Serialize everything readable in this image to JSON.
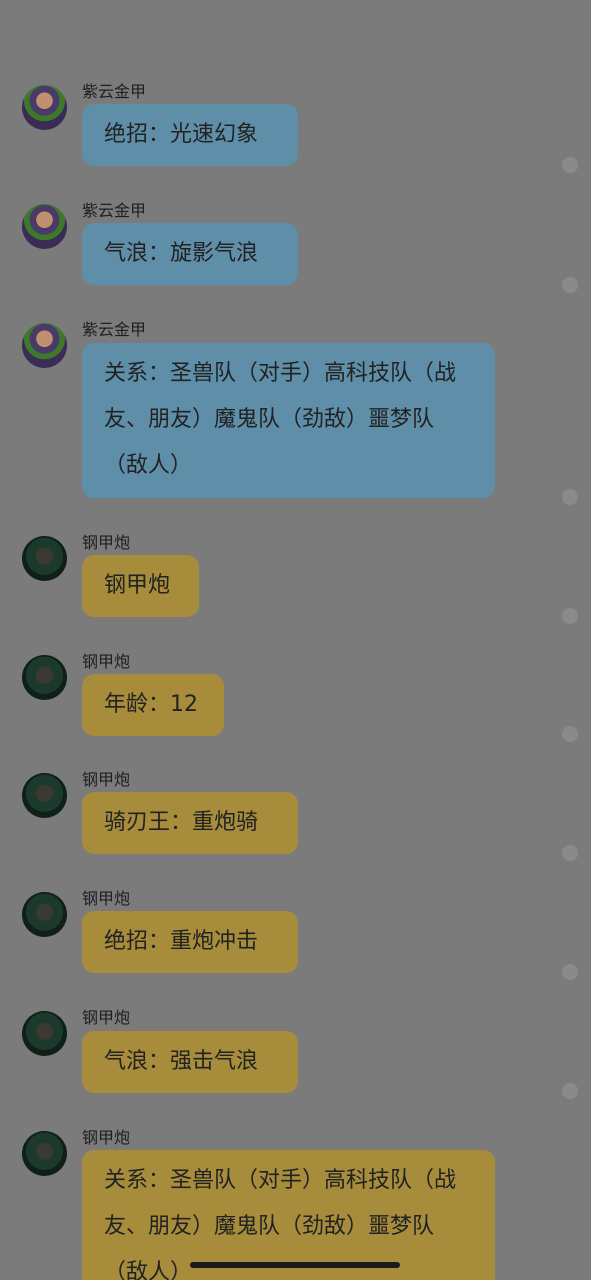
{
  "messages": [
    {
      "sender": "紫云金甲",
      "text": "绝招：光速幻象",
      "style": "blue",
      "avatar": "avatar-purple"
    },
    {
      "sender": "紫云金甲",
      "text": "气浪：旋影气浪",
      "style": "blue",
      "avatar": "avatar-purple"
    },
    {
      "sender": "紫云金甲",
      "text": "关系：圣兽队（对手）高科技队（战友、朋友）魔鬼队（劲敌）噩梦队（敌人）",
      "style": "blue",
      "avatar": "avatar-purple"
    },
    {
      "sender": "钢甲炮",
      "text": "钢甲炮",
      "style": "yellow",
      "avatar": "avatar-green"
    },
    {
      "sender": "钢甲炮",
      "text": "年龄：12",
      "style": "yellow",
      "avatar": "avatar-green"
    },
    {
      "sender": "钢甲炮",
      "text": "骑刃王：重炮骑",
      "style": "yellow",
      "avatar": "avatar-green"
    },
    {
      "sender": "钢甲炮",
      "text": "绝招：重炮冲击",
      "style": "yellow",
      "avatar": "avatar-green"
    },
    {
      "sender": "钢甲炮",
      "text": "气浪：强击气浪",
      "style": "yellow",
      "avatar": "avatar-green"
    },
    {
      "sender": "钢甲炮",
      "text": "关系：圣兽队（对手）高科技队（战友、朋友）魔鬼队（劲敌）噩梦队（敌人）",
      "style": "yellow",
      "avatar": "avatar-green"
    }
  ],
  "colors": {
    "blue_bubble": "#5f8fa8",
    "yellow_bubble": "#a68c3b",
    "background": "#7b7b7b"
  }
}
